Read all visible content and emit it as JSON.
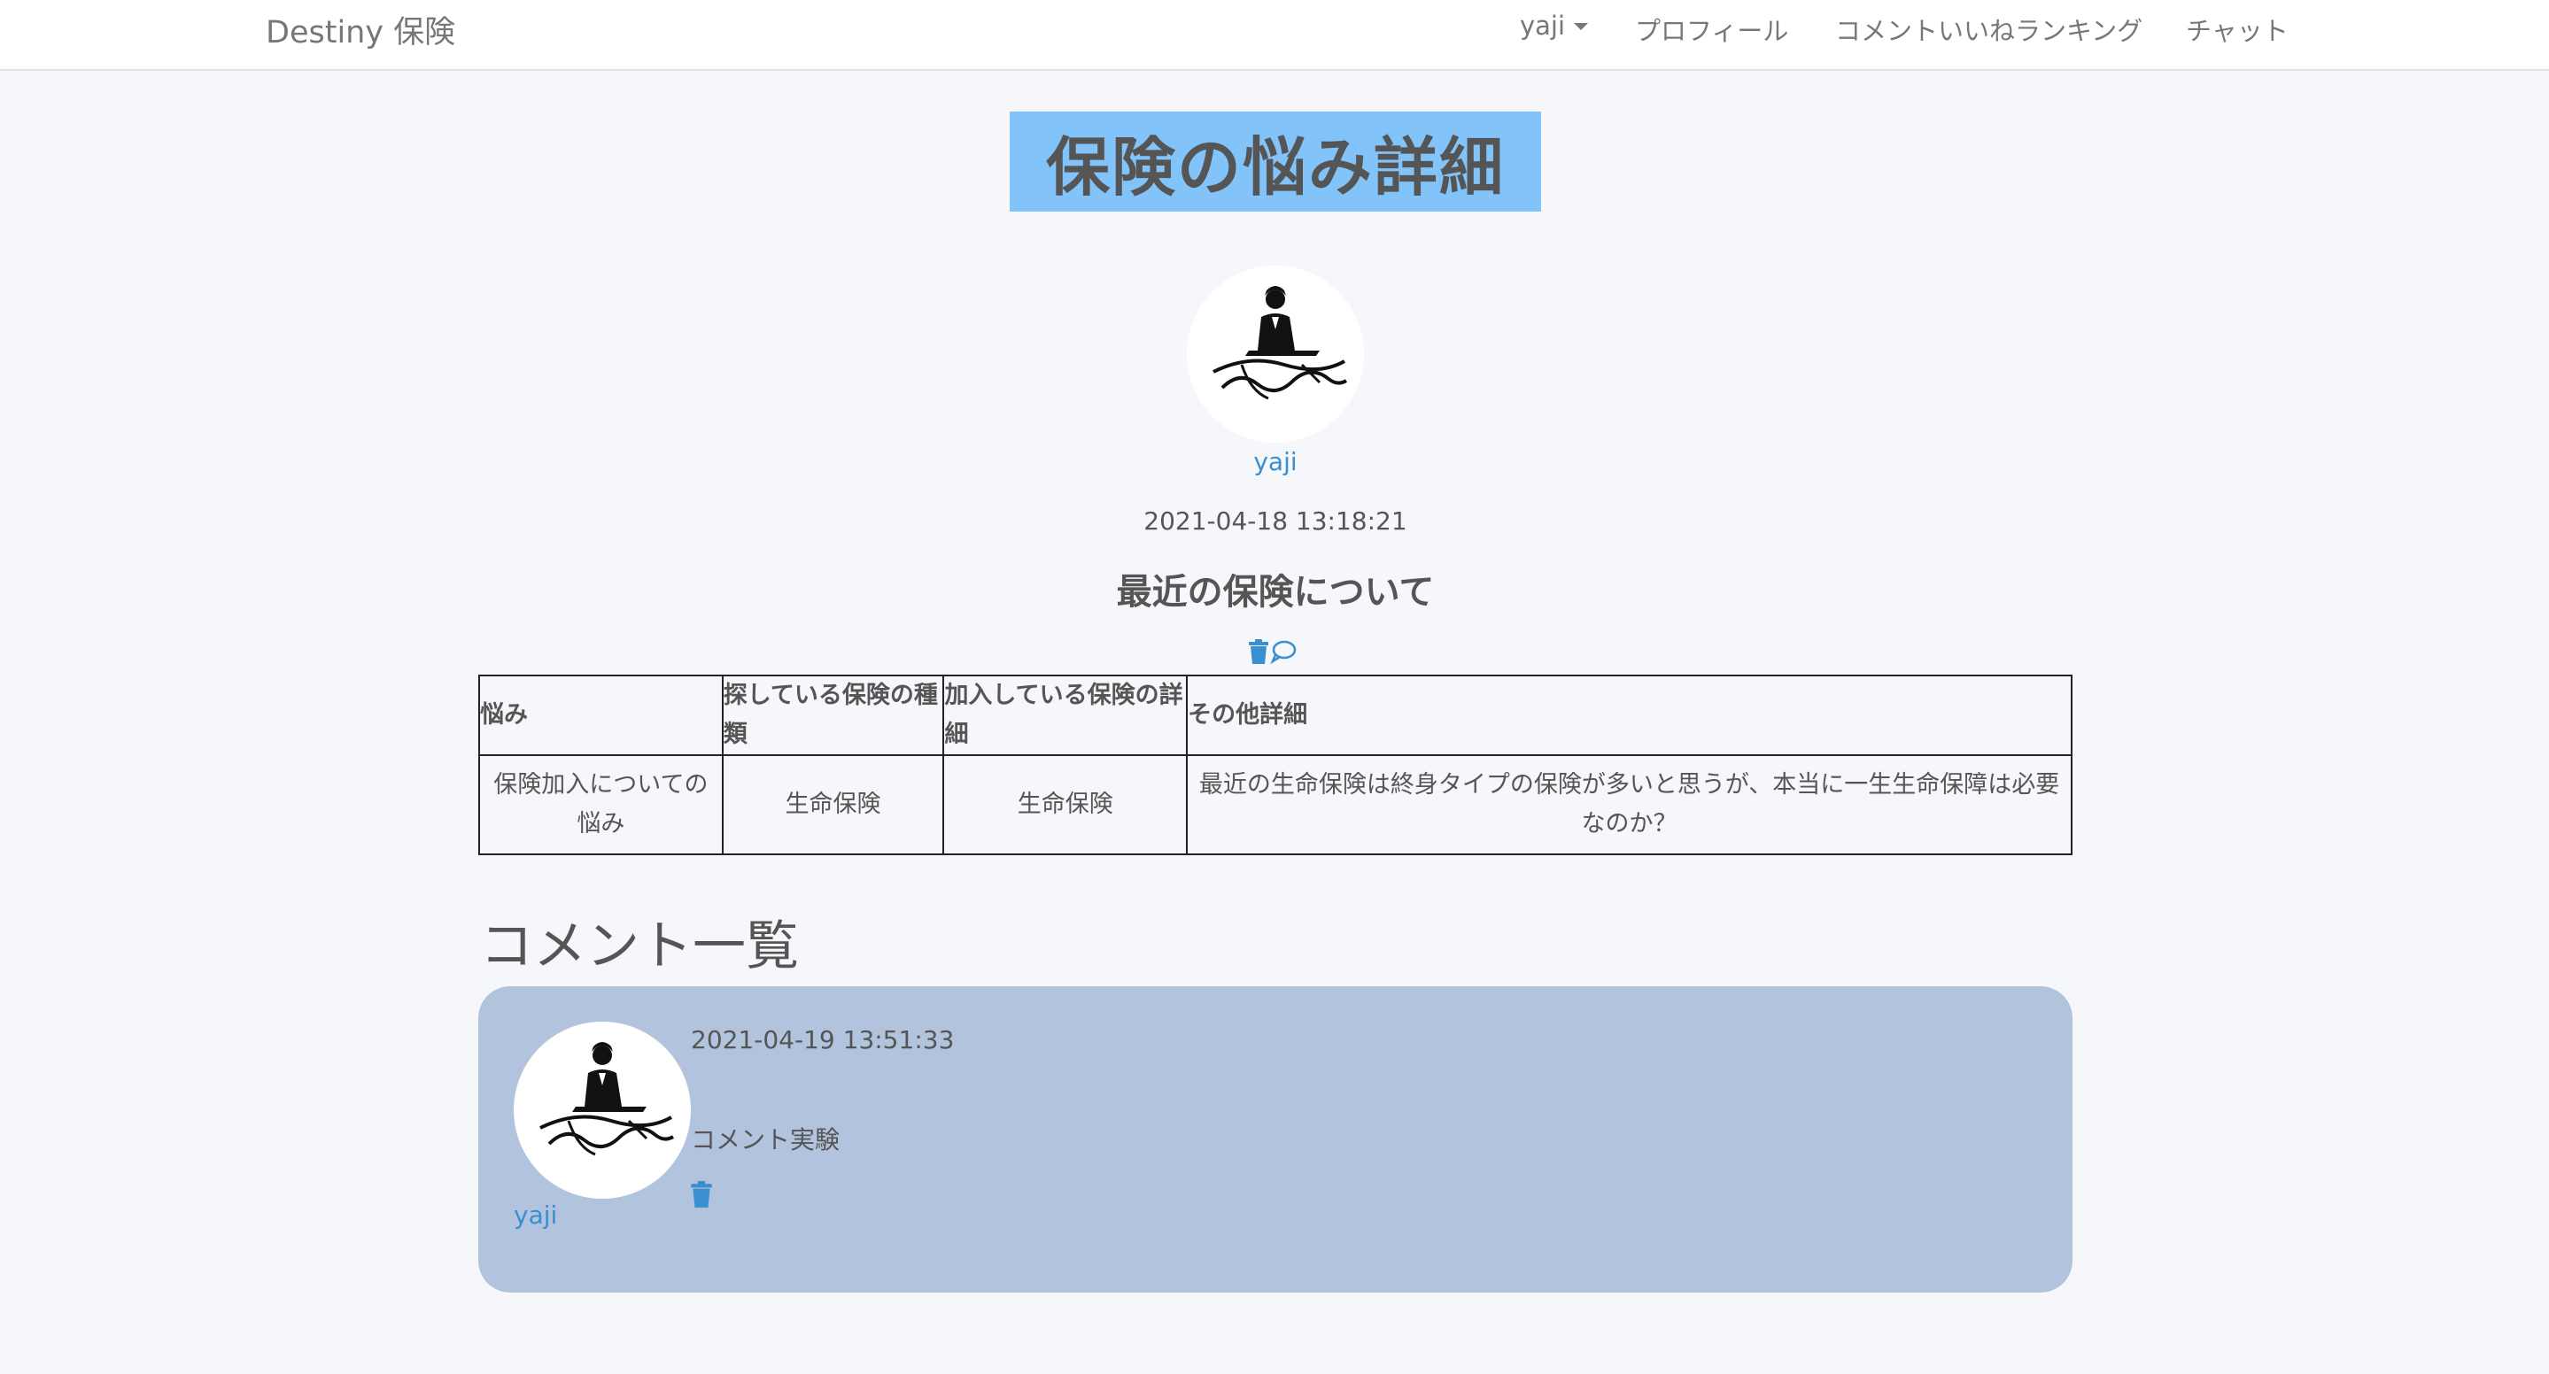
{
  "navbar": {
    "brand": "Destiny 保険",
    "user_menu": "yaji",
    "profile": "プロフィール",
    "ranking": "コメントいいねランキング",
    "chat": "チャット"
  },
  "page": {
    "title": "保険の悩み詳細"
  },
  "post": {
    "author": "yaji",
    "date": "2021-04-18 13:18:21",
    "title": "最近の保険について",
    "icons": [
      "trash-icon",
      "comment-icon"
    ]
  },
  "table": {
    "headers": [
      "悩み",
      "探している保険の種類",
      "加入している保険の詳細",
      "その他詳細"
    ],
    "row": [
      "保険加入についての悩み",
      "生命保険",
      "生命保険",
      "最近の生命保険は終身タイプの保険が多いと思うが、本当に一生生命保障は必要なのか？"
    ]
  },
  "comments": {
    "heading": "コメント一覧",
    "items": [
      {
        "author": "yaji",
        "date": "2021-04-19 13:51:33",
        "body": "コメント実験"
      }
    ]
  },
  "colors": {
    "title_bg": "#82c4fa",
    "link": "#3a8fd0",
    "comment_bg": "#b2c4dd",
    "page_bg": "#f5f7fa"
  }
}
